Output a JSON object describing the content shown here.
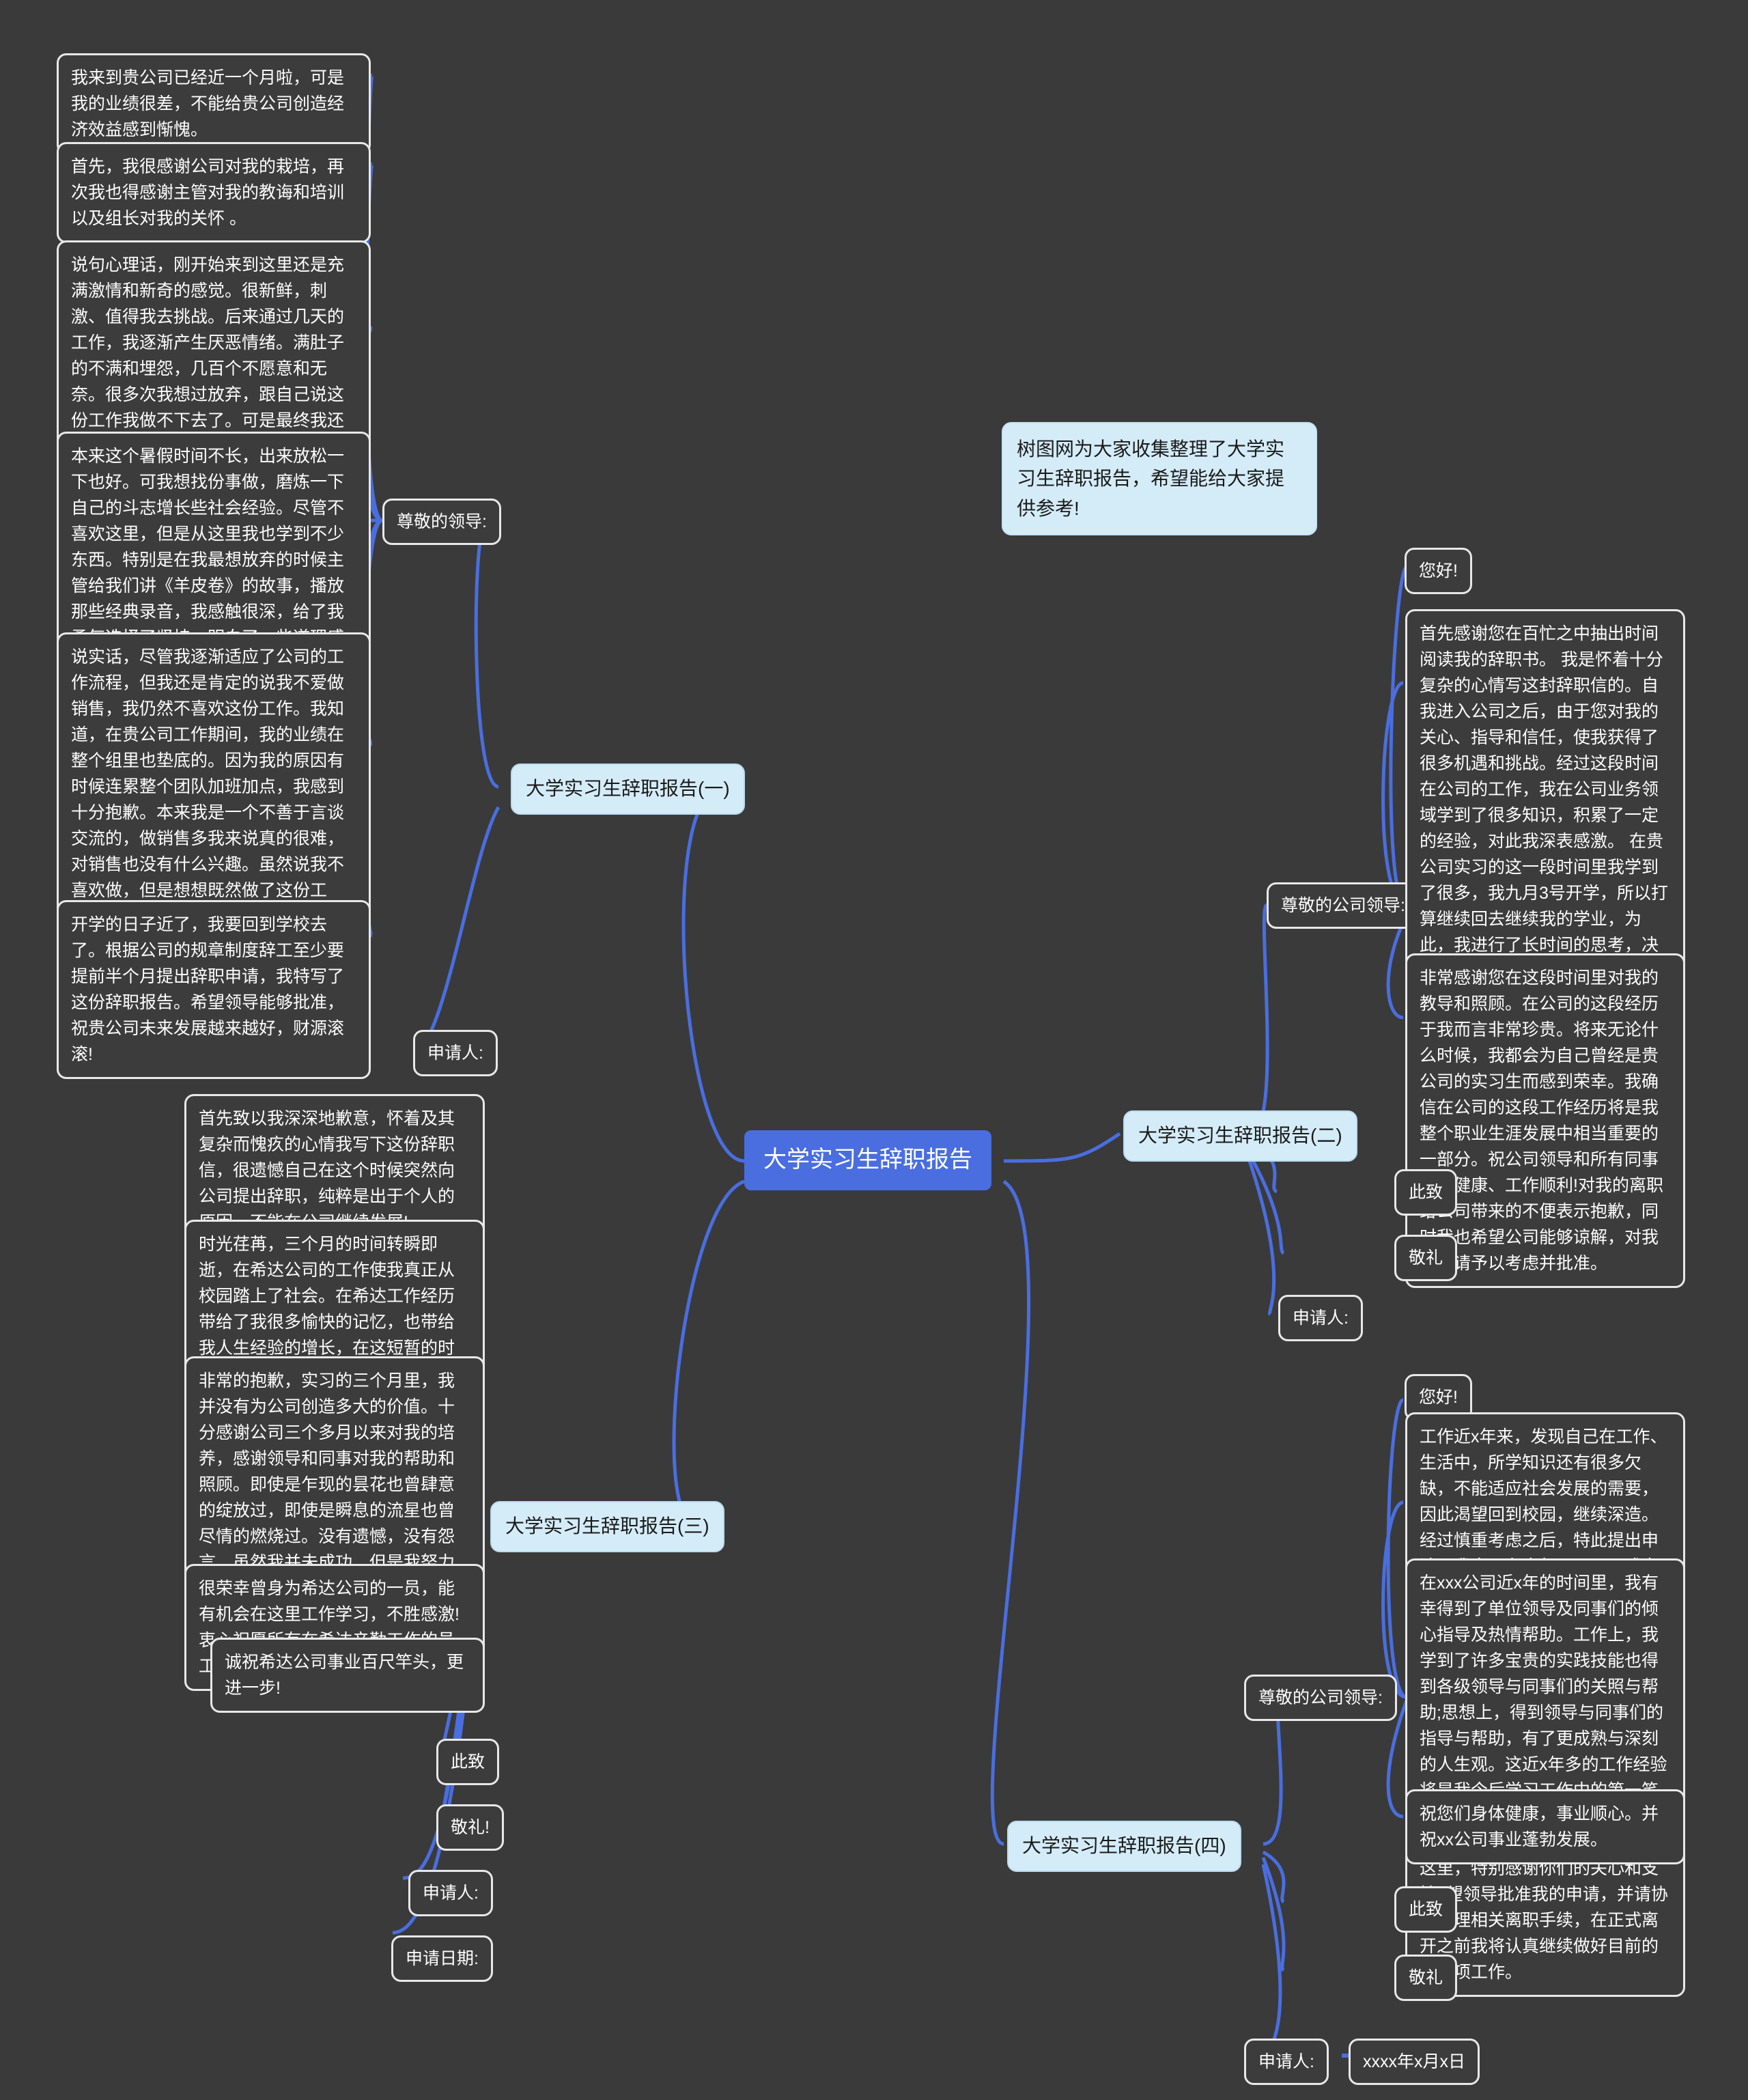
{
  "root": {
    "label": "大学实习生辞职报告"
  },
  "intro": {
    "text": "树图网为大家收集整理了大学实习生辞职报告，希望能给大家提供参考!"
  },
  "branches": [
    {
      "id": "b1",
      "label": "大学实习生辞职报告(一)"
    },
    {
      "id": "b2",
      "label": "大学实习生辞职报告(二)"
    },
    {
      "id": "b3",
      "label": "大学实习生辞职报告(三)"
    },
    {
      "id": "b4",
      "label": "大学实习生辞职报告(四)"
    }
  ],
  "b1": {
    "salutation": "尊敬的领导:",
    "applicant": "申请人:",
    "paragraphs": [
      "我来到贵公司已经近一个月啦，可是我的业绩很差，不能给贵公司创造经济效益感到惭愧。",
      "首先，我很感谢公司对我的栽培，再次我也得感谢主管对我的教诲和培训以及组长对我的关怀 。",
      "说句心理话，刚开始来到这里还是充满激情和新奇的感觉。很新鲜，刺激、值得我去挑战。后来通过几天的工作，我逐渐产生厌恶情绪。满肚子的不满和埋怨，几百个不愿意和无奈。很多次我想过放弃，跟自己说这份工作我做不下去了。可是最终我还是坚持了下来、毕竟时间不是很长，我是暑假工不会做太久的，因为不久我就要回学校啦。",
      "本来这个暑假时间不长，出来放松一下也好。可我想找份事做，磨炼一下自己的斗志增长些社会经验。尽管不喜欢这里，但是从这里我也学到不少东西。特别是在我最想放弃的时候主管给我们讲《羊皮卷》的故事，播放那些经典录音，我感触很深，给了我勇气选择了坚持。明白了一些道理感觉受益匪浅，我不会在轻易逃避退缩啦，没什么大不了，勇敢的面对一切吧!",
      "说实话，尽管我逐渐适应了公司的工作流程，但我还是肯定的说我不爱做销售，我仍然不喜欢这份工作。我知道，在贵公司工作期间，我的业绩在整个组里也垫底的。因为我的原因有时候连累整个团队加班加点，我感到十分抱歉。本来我是一个不善于言谈交流的，做销售多我来说真的很难，对销售也没有什么兴趣。虽然说我不喜欢做，但是想想既然做了这份工作，就要尽职尽责的去做，没有喜不喜欢这个借口，尽力去做好就行啦。组长一直很有耐心的指导帮助我去做事，对我也是特别\"关照\"了，成绩还是不理想，但我想我已经尽力啦!",
      "开学的日子近了，我要回到学校去了。根据公司的规章制度辞工至少要提前半个月提出辞职申请，我特写了这份辞职报告。希望领导能够批准，祝贵公司未来发展越来越好，财源滚滚!"
    ]
  },
  "b2": {
    "greeting": "您好!",
    "salutation": "尊敬的公司领导:",
    "applicant": "申请人:",
    "closing1": "此致",
    "closing2": "敬礼",
    "paragraphs": [
      "首先感谢您在百忙之中抽出时间阅读我的辞职书。 我是怀着十分复杂的心情写这封辞职信的。自我进入公司之后，由于您对我的关心、指导和信任，使我获得了很多机遇和挑战。经过这段时间在公司的工作，我在公司业务领域学到了很多知识，积累了一定的经验，对此我深表感激。 在贵公司实习的这一段时间里我学到了很多，我九月3号开学，所以打算继续回去继续我的学业，为此，我进行了长时间的思考，决定辞去这份实习工作!为了不因为我的离去的原因而影响到贵公司的发展进度，经过深思熟虑之后我决定辞去目前在公司和项目组所担任的职务和工作。我知道这个过程会给您带来一定程度上的不便，对此我深表抱歉。我已准备好在八月三十一号辞职从公司离职，并且在这段时间里完成工作交接，以减少因我的离职而给公司带来的不便。",
      "非常感谢您在这段时间里对我的教导和照顾。在公司的这段经历于我而言非常珍贵。将来无论什么时候，我都会为自己曾经是贵公司的实习生而感到荣幸。我确信在公司的这段工作经历将是我整个职业生涯发展中相当重要的一部分。祝公司领导和所有同事身体健康、工作顺利!对我的离职给公司带来的不便表示抱歉，同时我也希望公司能够谅解，对我的申请予以考虑并批准。"
    ]
  },
  "b3": {
    "applicant": "申请人:",
    "apply_date": "申请日期:",
    "closing1": "此致",
    "closing2": "敬礼!",
    "paragraphs": [
      "首先致以我深深地歉意，怀着及其复杂而愧疚的心情我写下这份辞职信，很遗憾自己在这个时候突然向公司提出辞职，纯粹是出于个人的原因，不能在公司继续发展!",
      "时光荏苒，三个月的时间转瞬即逝，在希达公司的工作使我真正从校园踏上了社会。在希达工作经历带给了我很多愉快的记忆，也带给我人生经验的增长，在这短暂的时间里我学到了很多。离开对于我个人来说或许是一种损失!",
      "非常的抱歉，实习的三个月里，我并没有为公司创造多大的价值。十分感谢公司三个多月以来对我的培养，感谢领导和同事对我的帮助和照顾。即使是乍现的昙花也曾肆意的绽放过，即使是瞬息的流星也曾尽情的燃烧过。没有遗憾，没有怨言，虽然我并未成功，但是我努力过。我在公司所接受的培养，在我的一生之中都没齿难忘。",
      "很荣幸曾身为希达公司的一员，能有机会在这里工作学习，不胜感激!衷心祝愿所有在希达辛勤工作的员工工作顺利，事业有成!",
      "诚祝希达公司事业百尺竿头，更进一步!"
    ]
  },
  "b4": {
    "greeting": "您好!",
    "salutation": "尊敬的公司领导:",
    "applicant": "申请人:",
    "date": "xxxx年x月x日",
    "closing1": "此致",
    "closing2": "敬礼",
    "paragraphs": [
      "工作近x年来，发现自己在工作、生活中，所学知识还有很多欠缺，不能适应社会发展的需要，因此渴望回到校园，继续深造。经过慎重考虑之后，特此提出申请：我自愿在今年x月x日正式离职。 请给与批准。",
      "在xxx公司近x年的时间里，我有幸得到了单位领导及同事们的倾心指导及热情帮助。工作上，我学到了许多宝贵的实践技能也得到各级领导与同事们的关照与帮助;思想上，得到领导与同事们的指导与帮助，有了更成熟与深刻的人生观。这近x年多的工作经验将是我今后学习工作中的第一笔宝贵的财富。 并且在短短的x年间获得了许多的机遇和挑战。 在这里，特别感谢你们的关心和支持. 望领导批准我的申请，并请协助办理相关离职手续，在正式离开之前我将认真继续做好目前的每一项工作。",
      "祝您们身体健康，事业顺心。并祝xx公司事业蓬勃发展。"
    ]
  },
  "colors": {
    "background": "#3a3a3a",
    "root_fill": "#4a6ee0",
    "branch_fill": "#d4ecf8",
    "leaf_fill": "#3c3c3c",
    "leaf_border": "#e8e8e8",
    "link": "#4a6ee0"
  }
}
